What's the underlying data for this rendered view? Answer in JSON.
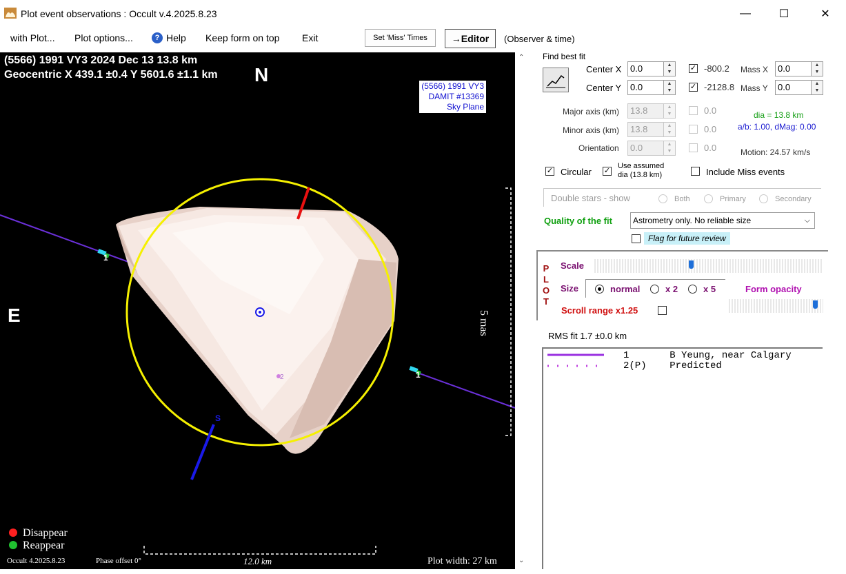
{
  "window": {
    "title": "Plot event observations : Occult v.4.2025.8.23",
    "min_glyph": "—",
    "max_glyph": "☐",
    "close_glyph": "✕"
  },
  "menu": {
    "with_plot": "with Plot...",
    "plot_options": "Plot options...",
    "help": "Help",
    "keep_on_top": "Keep form on top",
    "exit": "Exit",
    "set_miss_times": "Set 'Miss' Times",
    "editor": "→Editor",
    "observer_time": "(Observer & time)"
  },
  "plot": {
    "header_line1": "(5566) 1991 VY3  2024 Dec 13   13.8 km",
    "header_line2": "Geocentric  X  439.1 ±0.4  Y 5601.6 ±1.1 km",
    "north": "N",
    "east": "E",
    "south": "S",
    "sky_label": [
      "(5566) 1991 VY3",
      "DAMIT #13369",
      "Sky Plane"
    ],
    "scale_mas": "5 mas",
    "chord_label_1": "1",
    "chord_label_2": "1",
    "predicted_label": "2",
    "legend_disappear": "Disappear",
    "legend_reappear": "Reappear",
    "version": "Occult 4.2025.8.23",
    "phase_offset": "Phase offset 0°",
    "scale_km": "12.0 km",
    "plot_width": "Plot width: 27 km",
    "colors": {
      "ellipse": "#f5f000",
      "chord": "#6a30d8",
      "north_pole": "#e81010",
      "south_pole": "#1a1ae8",
      "disappear": "#ff2020",
      "reappear": "#20c030",
      "shape": "#f3e3dc"
    }
  },
  "fit": {
    "find_best_fit": "Find best fit",
    "center_x_label": "Center X",
    "center_x_value": "0.0",
    "center_y_label": "Center Y",
    "center_y_value": "0.0",
    "offset_x": "-800.2",
    "offset_y": "-2128.8",
    "mass_x_label": "Mass X",
    "mass_x_value": "0.0",
    "mass_y_label": "Mass Y",
    "mass_y_value": "0.0",
    "major_label": "Major axis (km)",
    "major_value": "13.8",
    "minor_label": "Minor axis (km)",
    "minor_value": "13.8",
    "orient_label": "Orientation",
    "orient_value": "0.0",
    "major_offset": "0.0",
    "minor_offset": "0.0",
    "orient_offset": "0.0",
    "dia": "dia = 13.8 km",
    "ab": "a/b: 1.00, dMag: 0.00",
    "motion": "Motion: 24.57 km/s",
    "circular": "Circular",
    "use_assumed_line1": "Use assumed",
    "use_assumed_line2": "dia (13.8 km)",
    "include_miss": "Include Miss events",
    "double_stars": "Double stars - show",
    "both": "Both",
    "primary": "Primary",
    "secondary": "Secondary",
    "quality_label": "Quality of the fit",
    "quality_value": "Astrometry only. No reliable size",
    "flag_review": "Flag for future review"
  },
  "plot_panel": {
    "plot_letters": [
      "P",
      "L",
      "O",
      "T"
    ],
    "scale": "Scale",
    "size": "Size",
    "normal": "normal",
    "x2": "x 2",
    "x5": "x 5",
    "form_opacity": "Form opacity",
    "scroll_range": "Scroll range x1.25",
    "scale_level": 0.42,
    "opacity_level": 0.94
  },
  "rms": "RMS fit 1.7 ±0.0 km",
  "observers": [
    {
      "num": "1   ",
      "name": "B Yeung, near Calgary"
    },
    {
      "num": "2(P)",
      "name": "Predicted"
    }
  ]
}
